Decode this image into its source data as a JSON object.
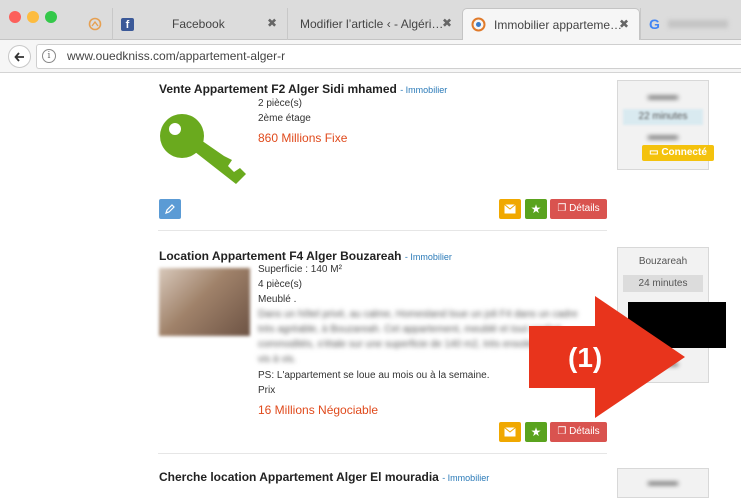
{
  "browser": {
    "tabs": [
      {
        "label": "",
        "icon": "pinned-tab-icon"
      },
      {
        "label": "Facebook",
        "icon": "facebook-icon"
      },
      {
        "label": "Modifier l’article ‹ - Algéri…",
        "icon": ""
      },
      {
        "label": "Immobilier apparteme…",
        "icon": "ouedkniss-icon"
      },
      {
        "label": "",
        "icon": "google-icon"
      }
    ],
    "close_glyph": "✖",
    "url": "www.ouedkniss.com/appartement-alger-r",
    "google_letter": "G"
  },
  "listings": [
    {
      "title": "Vente Appartement F2 Alger Sidi mhamed",
      "category": "- Immobilier",
      "details": [
        "2 pièce(s)",
        "2ème étage"
      ],
      "price": "860 Millions Fixe",
      "image": "green-key-icon"
    },
    {
      "title": "Location Appartement F4 Alger Bouzareah",
      "category": "- Immobilier",
      "details": [
        "Superficie : 140 M²",
        "4 pièce(s)",
        "Meublé ."
      ],
      "description_blurred": [
        "Dans un hôtel privé, au calme, Homesland loue un joli F4 dans un cadre",
        "très agréable, à Bouzareah. Cet appartement, meublé et tout confort",
        "commodités, s'étale sur une superficie de 140 m2, très ensoleillé",
        "vis à vis."
      ],
      "ps": "PS: L'appartement se loue au mois ou à la semaine.",
      "prix_label": "Prix",
      "price": "16 Millions Négociable",
      "sidebar": {
        "location": "Bouzareah",
        "time": "24 minutes"
      }
    },
    {
      "title": "Cherche location Appartement Alger El mouradia",
      "category": "- Immobilier"
    }
  ],
  "sidebar1": {
    "time": "22 minutes",
    "status": "Connecté"
  },
  "buttons": {
    "details": "Détails"
  },
  "annotation": {
    "label": "(1)",
    "color": "#e8341c"
  },
  "colors": {
    "price": "#e04a1c",
    "category": "#2a7ab8",
    "key": "#6aaa1e",
    "mail": "#f0a800",
    "star": "#5aa31e",
    "details": "#d9534f",
    "edit": "#5b9bd5",
    "connected": "#f4c20d"
  }
}
